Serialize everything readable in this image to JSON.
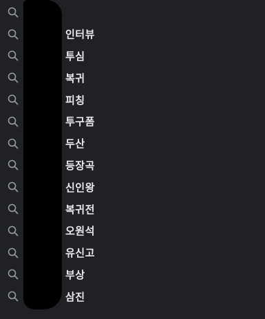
{
  "suggestions": {
    "items": [
      {
        "label": ""
      },
      {
        "label": "인터뷰"
      },
      {
        "label": "투심"
      },
      {
        "label": "복귀"
      },
      {
        "label": "피칭"
      },
      {
        "label": "투구폼"
      },
      {
        "label": "두산"
      },
      {
        "label": "등장곡"
      },
      {
        "label": "신인왕"
      },
      {
        "label": "복귀전"
      },
      {
        "label": "오원석"
      },
      {
        "label": "유신고"
      },
      {
        "label": "부상"
      },
      {
        "label": "삼진"
      }
    ],
    "icon": "search-icon",
    "colors": {
      "background": "#202124",
      "text": "#e8eaed",
      "icon": "#9aa0a6",
      "redaction": "#000000"
    }
  }
}
